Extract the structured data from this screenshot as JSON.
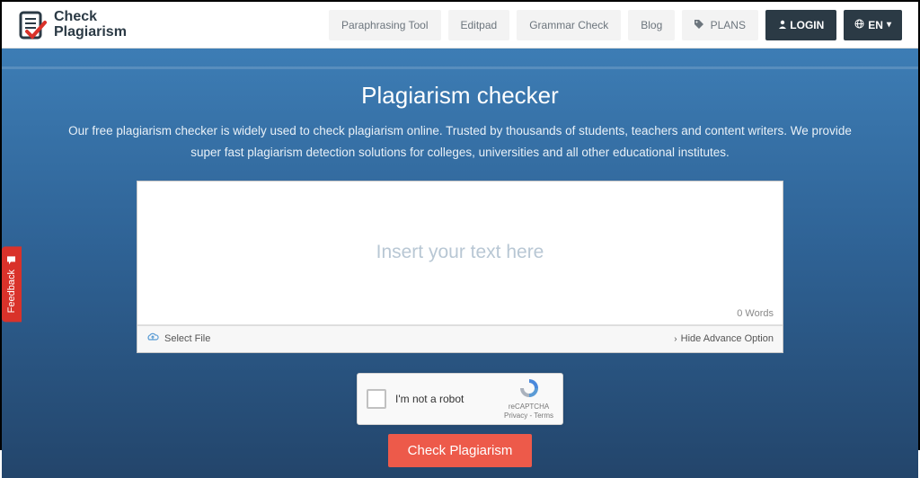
{
  "logo": {
    "line1": "Check",
    "line2": "Plagiarism"
  },
  "nav": {
    "paraphrase": "Paraphrasing Tool",
    "editpad": "Editpad",
    "grammar": "Grammar Check",
    "blog": "Blog",
    "plans": "PLANS",
    "login": "LOGIN",
    "lang": "EN"
  },
  "hero": {
    "title": "Plagiarism checker",
    "subtitle": "Our free plagiarism checker is widely used to check plagiarism online. Trusted by thousands of students, teachers and content writers. We provide super fast plagiarism detection solutions for colleges, universities and all other educational institutes."
  },
  "editor": {
    "placeholder": "Insert your text here",
    "word_count": "0 Words",
    "select_file": "Select File",
    "hide_advance": "Hide Advance Option"
  },
  "recaptcha": {
    "label": "I'm not a robot",
    "brand": "reCAPTCHA",
    "terms": "Privacy - Terms"
  },
  "cta": {
    "check": "Check Plagiarism"
  },
  "feedback": {
    "label": "Feedback"
  }
}
